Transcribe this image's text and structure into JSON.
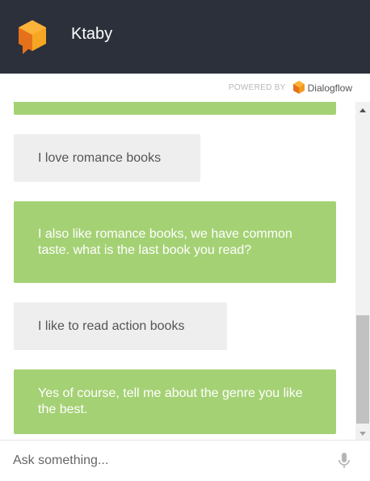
{
  "header": {
    "title": "Ktaby",
    "logo_icon": "agent-logo-icon",
    "background": "#2b303b"
  },
  "powered_by": {
    "label": "POWERED BY",
    "brand": "Dialogflow",
    "brand_icon": "dialogflow-logo-icon"
  },
  "conversation": {
    "messages": [
      {
        "from": "bot",
        "text": ""
      },
      {
        "from": "user",
        "text": "I love romance books"
      },
      {
        "from": "bot",
        "text": "I also like romance books, we have common taste. what is the last book you read?"
      },
      {
        "from": "user",
        "text": "I like to read action books"
      },
      {
        "from": "bot",
        "text": "Yes of course, tell me about the genre you like the best."
      }
    ],
    "bot_bubble_color": "#a5d175",
    "user_bubble_color": "#eeeeee"
  },
  "input": {
    "placeholder": "Ask something...",
    "value": "",
    "mic_icon": "microphone-icon"
  }
}
